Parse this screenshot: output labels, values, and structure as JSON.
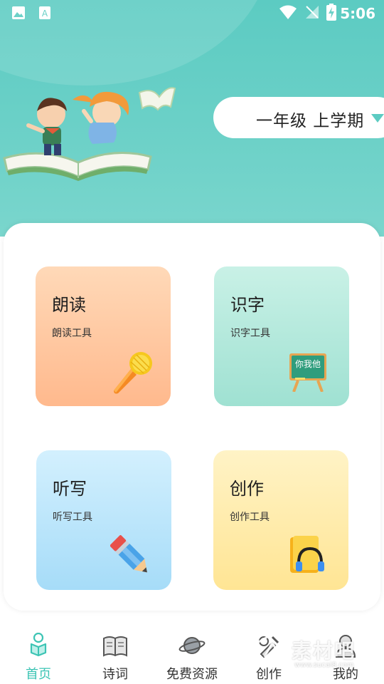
{
  "status_bar": {
    "time": "5:06"
  },
  "header": {
    "grade_selector": "一年级 上学期"
  },
  "tools": [
    {
      "title": "朗读",
      "subtitle": "朗读工具",
      "icon": "microphone-icon"
    },
    {
      "title": "识字",
      "subtitle": "识字工具",
      "icon": "chalkboard-icon",
      "board_text": "你我他"
    },
    {
      "title": "听写",
      "subtitle": "听写工具",
      "icon": "pencil-icon"
    },
    {
      "title": "创作",
      "subtitle": "创作工具",
      "icon": "book-headphones-icon"
    }
  ],
  "nav": [
    {
      "label": "首页",
      "icon": "home-reader-icon",
      "active": true
    },
    {
      "label": "诗词",
      "icon": "book-icon"
    },
    {
      "label": "免费资源",
      "icon": "planet-icon"
    },
    {
      "label": "创作",
      "icon": "tools-icon"
    },
    {
      "label": "我的",
      "icon": "user-icon"
    }
  ],
  "watermark": {
    "text": "素材吧",
    "sub": "www.sucai8.com"
  },
  "colors": {
    "teal": "#5ccbc2",
    "accent": "#3cc4b4",
    "card_read": "#ffb98d",
    "card_char": "#9fe1d2",
    "card_dict": "#a6dcf8",
    "card_write": "#ffe594"
  }
}
